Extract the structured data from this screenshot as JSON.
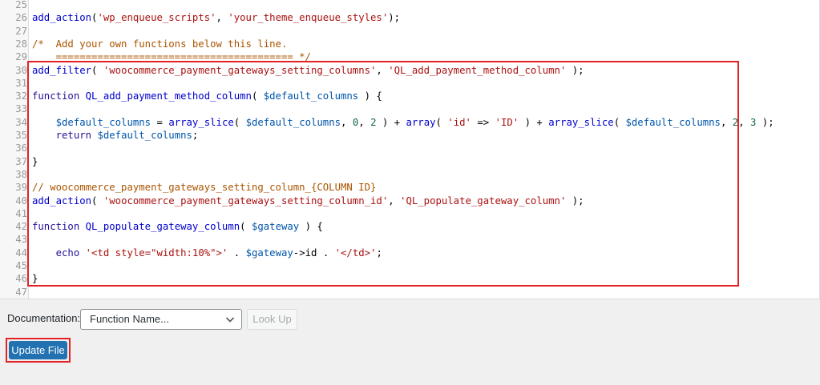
{
  "editor": {
    "lines": [
      {
        "num": "25",
        "tokens": []
      },
      {
        "num": "26",
        "tokens": [
          [
            "fn",
            "add_action"
          ],
          [
            "op",
            "("
          ],
          [
            "str",
            "'wp_enqueue_scripts'"
          ],
          [
            "op",
            ", "
          ],
          [
            "str",
            "'your_theme_enqueue_styles'"
          ],
          [
            "op",
            ");"
          ]
        ]
      },
      {
        "num": "27",
        "tokens": []
      },
      {
        "num": "28",
        "tokens": [
          [
            "cm",
            "/*  Add your own functions below this line."
          ]
        ]
      },
      {
        "num": "29",
        "tokens": [
          [
            "cm",
            "    ======================================== */"
          ]
        ]
      },
      {
        "num": "30",
        "tokens": [
          [
            "fn",
            "add_filter"
          ],
          [
            "op",
            "( "
          ],
          [
            "str",
            "'woocommerce_payment_gateways_setting_columns'"
          ],
          [
            "op",
            ", "
          ],
          [
            "str",
            "'QL_add_payment_method_column'"
          ],
          [
            "op",
            " );"
          ]
        ]
      },
      {
        "num": "31",
        "tokens": []
      },
      {
        "num": "32",
        "tokens": [
          [
            "kw",
            "function"
          ],
          [
            "op",
            " "
          ],
          [
            "fn",
            "QL_add_payment_method_column"
          ],
          [
            "op",
            "( "
          ],
          [
            "var",
            "$default_columns"
          ],
          [
            "op",
            " ) {"
          ]
        ]
      },
      {
        "num": "33",
        "tokens": []
      },
      {
        "num": "34",
        "tokens": [
          [
            "op",
            "    "
          ],
          [
            "var",
            "$default_columns"
          ],
          [
            "op",
            " = "
          ],
          [
            "fn",
            "array_slice"
          ],
          [
            "op",
            "( "
          ],
          [
            "var",
            "$default_columns"
          ],
          [
            "op",
            ", "
          ],
          [
            "num",
            "0"
          ],
          [
            "op",
            ", "
          ],
          [
            "num",
            "2"
          ],
          [
            "op",
            " ) + "
          ],
          [
            "fn",
            "array"
          ],
          [
            "op",
            "( "
          ],
          [
            "str",
            "'id'"
          ],
          [
            "op",
            " => "
          ],
          [
            "str",
            "'ID'"
          ],
          [
            "op",
            " ) + "
          ],
          [
            "fn",
            "array_slice"
          ],
          [
            "op",
            "( "
          ],
          [
            "var",
            "$default_columns"
          ],
          [
            "op",
            ", "
          ],
          [
            "num",
            "2"
          ],
          [
            "op",
            ", "
          ],
          [
            "num",
            "3"
          ],
          [
            "op",
            " );"
          ]
        ]
      },
      {
        "num": "35",
        "tokens": [
          [
            "op",
            "    "
          ],
          [
            "kw",
            "return"
          ],
          [
            "op",
            " "
          ],
          [
            "var",
            "$default_columns"
          ],
          [
            "op",
            ";"
          ]
        ]
      },
      {
        "num": "36",
        "tokens": []
      },
      {
        "num": "37",
        "tokens": [
          [
            "op",
            "}"
          ]
        ]
      },
      {
        "num": "38",
        "tokens": []
      },
      {
        "num": "39",
        "tokens": [
          [
            "cm",
            "// woocommerce_payment_gateways_setting_column_{COLUMN ID}"
          ]
        ]
      },
      {
        "num": "40",
        "tokens": [
          [
            "fn",
            "add_action"
          ],
          [
            "op",
            "( "
          ],
          [
            "str",
            "'woocommerce_payment_gateways_setting_column_id'"
          ],
          [
            "op",
            ", "
          ],
          [
            "str",
            "'QL_populate_gateway_column'"
          ],
          [
            "op",
            " );"
          ]
        ]
      },
      {
        "num": "41",
        "tokens": []
      },
      {
        "num": "42",
        "tokens": [
          [
            "kw",
            "function"
          ],
          [
            "op",
            " "
          ],
          [
            "fn",
            "QL_populate_gateway_column"
          ],
          [
            "op",
            "( "
          ],
          [
            "var",
            "$gateway"
          ],
          [
            "op",
            " ) {"
          ]
        ]
      },
      {
        "num": "43",
        "tokens": []
      },
      {
        "num": "44",
        "tokens": [
          [
            "op",
            "    "
          ],
          [
            "kw",
            "echo"
          ],
          [
            "op",
            " "
          ],
          [
            "str",
            "'<td style=\"width:10%\">'"
          ],
          [
            "op",
            " . "
          ],
          [
            "var",
            "$gateway"
          ],
          [
            "op",
            "->id . "
          ],
          [
            "str",
            "'</td>'"
          ],
          [
            "op",
            ";"
          ]
        ]
      },
      {
        "num": "45",
        "tokens": []
      },
      {
        "num": "46",
        "tokens": [
          [
            "op",
            "}"
          ]
        ]
      },
      {
        "num": "47",
        "tokens": []
      }
    ]
  },
  "documentation": {
    "label": "Documentation:",
    "select_value": "Function Name...",
    "lookup_label": "Look Up"
  },
  "update_label": "Update File",
  "colors": {
    "highlight": "#e32226",
    "primary": "#2271b1"
  },
  "icons": {
    "select_chevron": "chevron-down-icon"
  }
}
